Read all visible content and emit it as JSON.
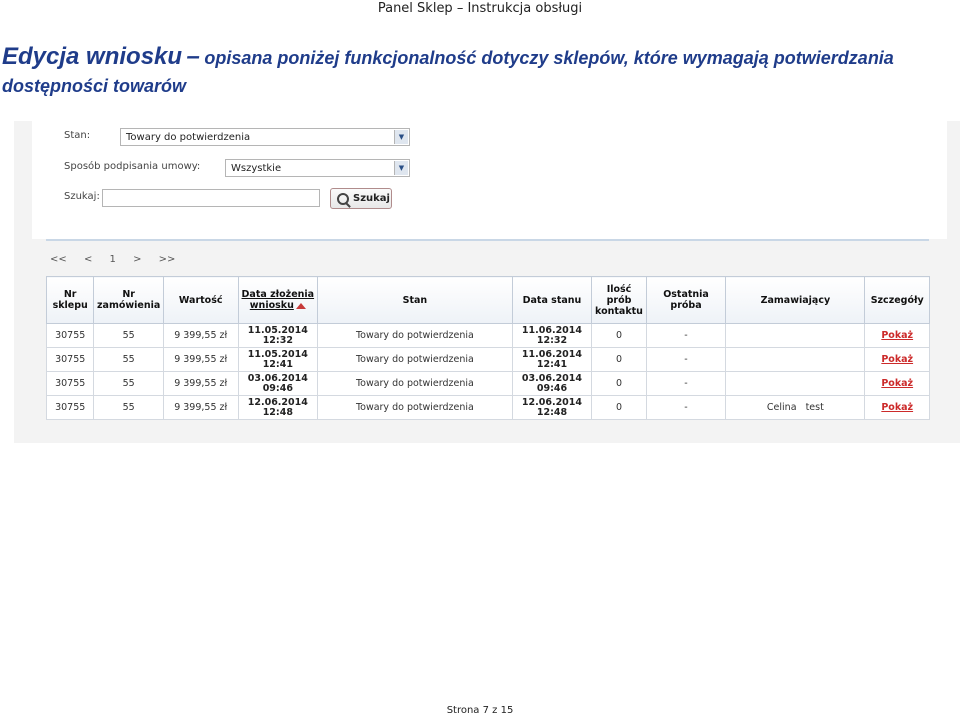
{
  "document": {
    "header": "Panel Sklep – Instrukcja obsługi",
    "heading_main": "Edycja wniosku",
    "heading_dash": "–",
    "heading_rest": "opisana poniżej funkcjonalność dotyczy sklepów, które wymagają potwierdzania",
    "heading_second": "dostępności towarów",
    "footer": "Strona 7 z 15"
  },
  "filters": {
    "stan_label": "Stan:",
    "stan_value": "Towary do potwierdzenia",
    "sposob_label": "Sposób podpisania umowy:",
    "sposob_value": "Wszystkie",
    "szukaj_label": "Szukaj:",
    "szukaj_value": "",
    "szukaj_button": "Szukaj"
  },
  "pager": {
    "first": "<<",
    "prev": "<",
    "page": "1",
    "next": ">",
    "last": ">>"
  },
  "table": {
    "columns": [
      {
        "line1": "Nr",
        "line2": "sklepu"
      },
      {
        "line1": "Nr",
        "line2": "zamówienia"
      },
      {
        "line1": "Wartość",
        "line2": ""
      },
      {
        "line1": "Data złożenia",
        "line2": "wniosku"
      },
      {
        "line1": "Stan",
        "line2": ""
      },
      {
        "line1": "Data stanu",
        "line2": ""
      },
      {
        "line1": "Ilość",
        "line2": "prób",
        "line3": "kontaktu"
      },
      {
        "line1": "Ostatnia",
        "line2": "próba"
      },
      {
        "line1": "Zamawiający",
        "line2": ""
      },
      {
        "line1": "Szczegóły",
        "line2": ""
      }
    ],
    "rows": [
      {
        "sklep": "30755",
        "zamowienie": "55",
        "wartosc": "9 399,55 zł",
        "data_d": "11.05.2014",
        "data_t": "12:32",
        "stan": "Towary do potwierdzenia",
        "stan_d": "11.06.2014",
        "stan_t": "12:32",
        "ilosc": "0",
        "ostatnia": "-",
        "zamawiajacy": "",
        "szczegoly": "Pokaż"
      },
      {
        "sklep": "30755",
        "zamowienie": "55",
        "wartosc": "9 399,55 zł",
        "data_d": "11.05.2014",
        "data_t": "12:41",
        "stan": "Towary do potwierdzenia",
        "stan_d": "11.06.2014",
        "stan_t": "12:41",
        "ilosc": "0",
        "ostatnia": "-",
        "zamawiajacy": "",
        "szczegoly": "Pokaż"
      },
      {
        "sklep": "30755",
        "zamowienie": "55",
        "wartosc": "9 399,55 zł",
        "data_d": "03.06.2014",
        "data_t": "09:46",
        "stan": "Towary do potwierdzenia",
        "stan_d": "03.06.2014",
        "stan_t": "09:46",
        "ilosc": "0",
        "ostatnia": "-",
        "zamawiajacy": "",
        "szczegoly": "Pokaż"
      },
      {
        "sklep": "30755",
        "zamowienie": "55",
        "wartosc": "9 399,55 zł",
        "data_d": "12.06.2014",
        "data_t": "12:48",
        "stan": "Towary do potwierdzenia",
        "stan_d": "12.06.2014",
        "stan_t": "12:48",
        "ilosc": "0",
        "ostatnia": "-",
        "zamawiajacy": "Celina   test",
        "szczegoly": "Pokaż"
      }
    ]
  }
}
